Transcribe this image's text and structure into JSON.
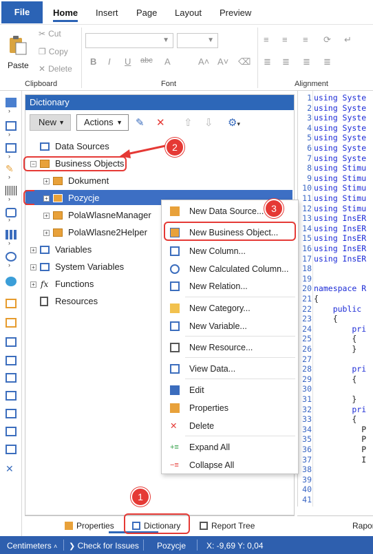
{
  "ribbon_tabs": [
    "File",
    "Home",
    "Insert",
    "Page",
    "Layout",
    "Preview"
  ],
  "clipboard": {
    "paste": "Paste",
    "cut": "Cut",
    "copy": "Copy",
    "delete": "Delete",
    "label": "Clipboard"
  },
  "font_group": {
    "label": "Font"
  },
  "alignment_group": {
    "label": "Alignment"
  },
  "dictionary": {
    "title": "Dictionary",
    "new_label": "New",
    "actions_label": "Actions",
    "tree": [
      {
        "label": "Data Sources"
      },
      {
        "label": "Business Objects"
      },
      {
        "label": "Dokument"
      },
      {
        "label": "Pozycje"
      },
      {
        "label": "PolaWlasneManager"
      },
      {
        "label": "PolaWlasne2Helper"
      },
      {
        "label": "Variables"
      },
      {
        "label": "System Variables"
      },
      {
        "label": "Functions"
      },
      {
        "label": "Resources"
      }
    ]
  },
  "context_menu": [
    {
      "label": "New Data Source...",
      "icon": "new-data-source-icon"
    },
    {
      "label": "New Business Object...",
      "icon": "new-business-object-icon"
    },
    {
      "label": "New Column...",
      "icon": "new-column-icon"
    },
    {
      "label": "New Calculated Column...",
      "icon": "new-calculated-column-icon"
    },
    {
      "label": "New Relation...",
      "icon": "new-relation-icon"
    },
    {
      "label": "New Category...",
      "icon": "folder-icon"
    },
    {
      "label": "New Variable...",
      "icon": "new-variable-icon"
    },
    {
      "label": "New Resource...",
      "icon": "new-resource-icon"
    },
    {
      "label": "View Data...",
      "icon": "view-data-icon"
    },
    {
      "label": "Edit",
      "icon": "edit-icon"
    },
    {
      "label": "Properties",
      "icon": "properties-icon"
    },
    {
      "label": "Delete",
      "icon": "delete-icon"
    },
    {
      "label": "Expand All",
      "icon": "expand-all-icon"
    },
    {
      "label": "Collapse All",
      "icon": "collapse-all-icon"
    }
  ],
  "code": {
    "lines": [
      {
        "n": "1",
        "text": "using Syste"
      },
      {
        "n": "2",
        "text": "using Syste"
      },
      {
        "n": "3",
        "text": "using Syste"
      },
      {
        "n": "4",
        "text": "using Syste"
      },
      {
        "n": "5",
        "text": "using Syste"
      },
      {
        "n": "6",
        "text": "using Syste"
      },
      {
        "n": "7",
        "text": "using Syste"
      },
      {
        "n": "8",
        "text": "using Stimu"
      },
      {
        "n": "9",
        "text": "using Stimu"
      },
      {
        "n": "10",
        "text": "using Stimu"
      },
      {
        "n": "11",
        "text": "using Stimu"
      },
      {
        "n": "12",
        "text": "using Stimu"
      },
      {
        "n": "13",
        "text": "using InsER"
      },
      {
        "n": "14",
        "text": "using InsER"
      },
      {
        "n": "15",
        "text": "using InsER"
      },
      {
        "n": "16",
        "text": "using InsER"
      },
      {
        "n": "17",
        "text": "using InsER"
      },
      {
        "n": "18",
        "text": ""
      },
      {
        "n": "19",
        "text": ""
      },
      {
        "n": "20",
        "text": "namespace R"
      },
      {
        "n": "21",
        "text": "{"
      },
      {
        "n": "22",
        "text": "    public "
      },
      {
        "n": "23",
        "text": "    {"
      },
      {
        "n": "24",
        "text": "        pri"
      },
      {
        "n": "25",
        "text": "        {"
      },
      {
        "n": "26",
        "text": "        }"
      },
      {
        "n": "27",
        "text": ""
      },
      {
        "n": "28",
        "text": "        pri"
      },
      {
        "n": "29",
        "text": "        {"
      },
      {
        "n": "30",
        "text": ""
      },
      {
        "n": "31",
        "text": "        }"
      },
      {
        "n": "32",
        "text": "        pri"
      },
      {
        "n": "33",
        "text": "        {"
      },
      {
        "n": "34",
        "text": "          P"
      },
      {
        "n": "35",
        "text": "          P"
      },
      {
        "n": "36",
        "text": "          P"
      },
      {
        "n": "37",
        "text": "          I"
      },
      {
        "n": "38",
        "text": ""
      },
      {
        "n": "39",
        "text": ""
      },
      {
        "n": "40",
        "text": ""
      },
      {
        "n": "41",
        "text": ""
      }
    ]
  },
  "bottom_tabs": {
    "properties": "Properties",
    "dictionary": "Dictionary",
    "report_tree": "Report Tree",
    "raport": "Rapor"
  },
  "status": {
    "units": "Centimeters",
    "check": "Check for Issues",
    "component": "Pozycje",
    "coords": "X: -9,69 Y: 0,04"
  },
  "callouts": [
    "1",
    "2",
    "3"
  ],
  "colors": {
    "accent": "#2d67b8",
    "selection": "#3d6fc4",
    "callout": "#e53935",
    "status_bar": "#2e5fae"
  }
}
